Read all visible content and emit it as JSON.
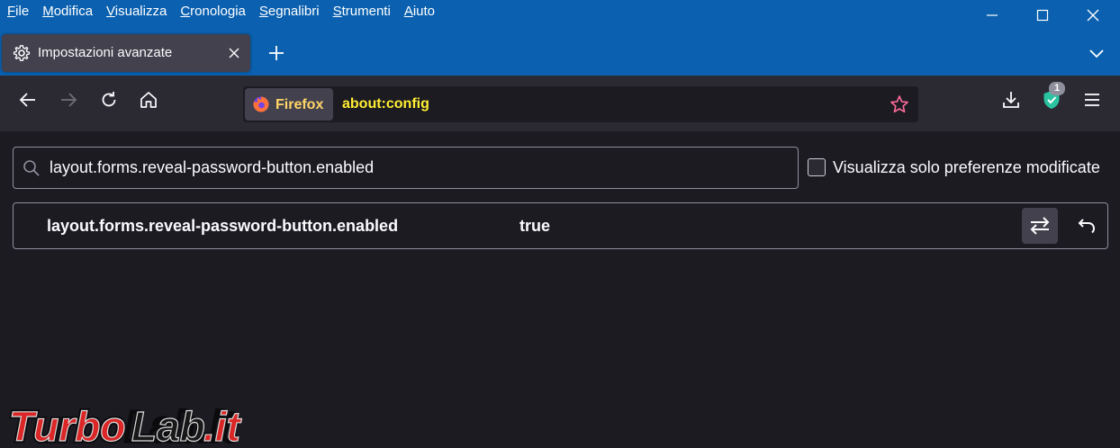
{
  "menubar": {
    "items": [
      {
        "accel": "F",
        "rest": "ile"
      },
      {
        "accel": "M",
        "rest": "odifica"
      },
      {
        "accel": "V",
        "rest": "isualizza"
      },
      {
        "accel": "C",
        "rest": "ronologia"
      },
      {
        "accel": "S",
        "rest": "egnalibri"
      },
      {
        "accel": "S",
        "rest": "trumenti"
      },
      {
        "accel": "A",
        "rest": "iuto"
      }
    ]
  },
  "tab": {
    "title": "Impostazioni avanzate",
    "icon": "gear-icon"
  },
  "urlbar": {
    "identity_label": "Firefox",
    "url": "about:config"
  },
  "toolbar": {
    "shield_badge": "1"
  },
  "search": {
    "value": "layout.forms.reveal-password-button.enabled"
  },
  "filter": {
    "label": "Visualizza solo preferenze modificate",
    "checked": false
  },
  "preference": {
    "name": "layout.forms.reveal-password-button.enabled",
    "value": "true"
  },
  "watermark": {
    "text_part1": "Turbo",
    "text_part2": "Lab",
    "text_part3": ".it"
  },
  "colors": {
    "titlebar": "#0b61b0",
    "url_text": "#ffee32",
    "background": "#1c1b22"
  }
}
